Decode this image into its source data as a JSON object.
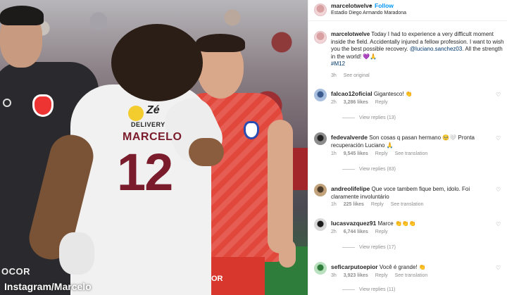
{
  "photo": {
    "watermark": "Instagram/Marcelo",
    "shirt_name": "MARCELO",
    "shirt_number": "12",
    "sponsor_logo": "Zé",
    "sponsor_text": "DELIVERY",
    "gk_sponsor": "OCOR",
    "red_sponsor": "ANGIOCOR"
  },
  "post": {
    "username": "marcelotwelve",
    "follow_label": "Follow",
    "location": "Estadio Diego Armando Maradona",
    "caption": {
      "username": "marcelotwelve",
      "text_1": "Today I had to experience a very difficult moment inside the field. Accidentally injured a fellow profession. I want to wish you the best possible recovery.",
      "mention": "@luciano.sanchez03",
      "text_2": ". All the strength in the world! 💜🙏",
      "hashtag": "#M12",
      "time": "3h",
      "see_original": "See original"
    }
  },
  "comments": [
    {
      "username": "falcao12oficial",
      "text": "Gigantesco! 👏",
      "time": "2h",
      "likes": "3,286 likes",
      "reply": "Reply",
      "translation": "",
      "view_replies": "View replies (13)"
    },
    {
      "username": "fedevalverde",
      "text": "Son cosas q pasan hermano 🥺🤍 Pronta recuperación Luciano 🙏",
      "time": "1h",
      "likes": "9,545 likes",
      "reply": "Reply",
      "translation": "See translation",
      "view_replies": "View replies (83)"
    },
    {
      "username": "andreolifelipe",
      "text": "Que voce tambem fique bem, idolo. Foi claramente involuntário",
      "time": "1h",
      "likes": "225 likes",
      "reply": "Reply",
      "translation": "See translation",
      "view_replies": ""
    },
    {
      "username": "lucasvazquez91",
      "text": "Marce 👏👏👏",
      "time": "2h",
      "likes": "6,744 likes",
      "reply": "Reply",
      "translation": "",
      "view_replies": "View replies (17)"
    },
    {
      "username": "seficarputoepior",
      "text": "Você é grande! 👏",
      "time": "3h",
      "likes": "3,923 likes",
      "reply": "Reply",
      "translation": "See translation",
      "view_replies": "View replies (11)"
    }
  ]
}
